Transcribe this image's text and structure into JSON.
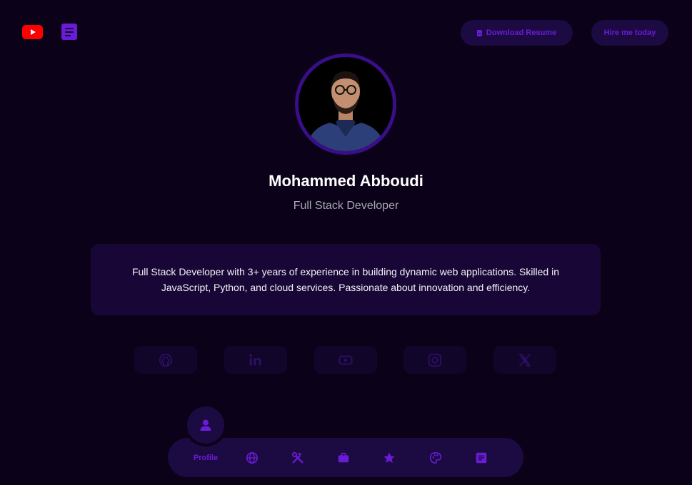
{
  "header": {
    "youtube_icon": "youtube-icon",
    "blog_icon": "document-icon",
    "download_resume_label": "Download Resume",
    "hire_me_label": "Hire me today"
  },
  "profile": {
    "name": "Mohammed Abboudi",
    "title": "Full Stack Developer",
    "bio": "Full Stack Developer with 3+ years of experience in building dynamic web applications. Skilled in JavaScript, Python, and cloud services. Passionate about innovation and efficiency."
  },
  "socials": [
    "github-icon",
    "linkedin-icon",
    "youtube-icon",
    "instagram-icon",
    "x-icon"
  ],
  "nav": {
    "active_label": "Profile",
    "items": [
      "profile-icon",
      "globe-icon",
      "tools-icon",
      "briefcase-icon",
      "star-icon",
      "palette-icon",
      "document-icon"
    ]
  },
  "colors": {
    "background": "#0b0219",
    "accent": "#6a1bd6",
    "surface": "#1c0b42",
    "card": "#180736",
    "youtube_red": "#ff0000"
  }
}
